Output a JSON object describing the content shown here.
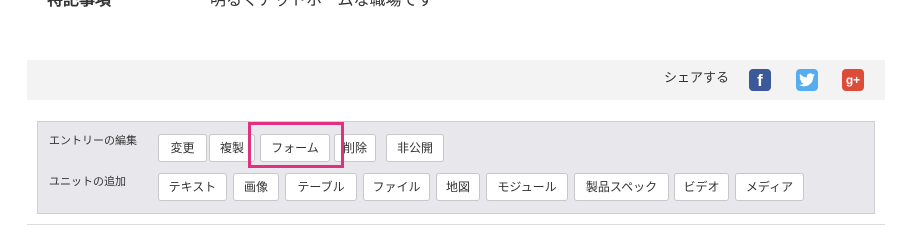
{
  "detail": {
    "label": "特記事項",
    "value": "明るくアットホームな職場です"
  },
  "share": {
    "label": "シェアする",
    "facebook_glyph": "f",
    "twitter_glyph": "t",
    "googleplus_glyph": "g+",
    "colors": {
      "facebook": "#3b5998",
      "twitter": "#55acee",
      "googleplus": "#dd4b39"
    }
  },
  "admin": {
    "entry_edit_label": "エントリーの編集",
    "entry_buttons": [
      "変更",
      "複製",
      "フォーム",
      "削除",
      "非公開"
    ],
    "unit_add_label": "ユニットの追加",
    "unit_buttons": [
      "テキスト",
      "画像",
      "テーブル",
      "ファイル",
      "地図",
      "モジュール",
      "製品スペック",
      "ビデオ",
      "メディア"
    ],
    "highlight_color": "#e0307f"
  }
}
